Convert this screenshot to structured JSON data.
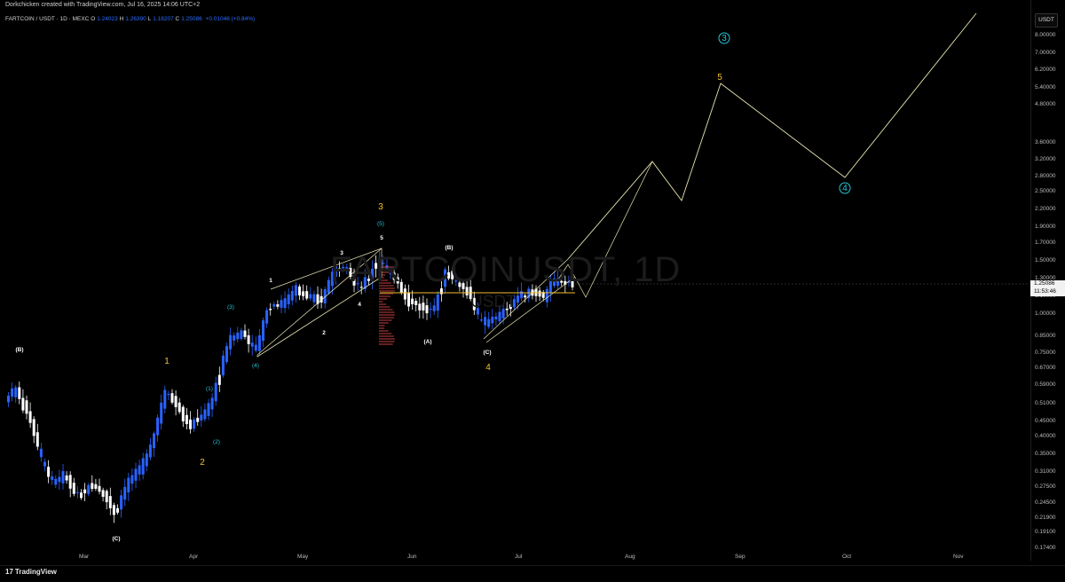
{
  "caption": "Dorkchicken created with TradingView.com, Jul 16, 2025 14:06 UTC+2",
  "symbol": {
    "title": "FARTCOIN / USDT · 1D · MEXC",
    "o_label": "O",
    "o": "1.24023",
    "h_label": "H",
    "h": "1.26390",
    "l_label": "L",
    "l": "1.18207",
    "c_label": "C",
    "c": "1.25086",
    "change": "+0.01046 (+0.84%)"
  },
  "watermark": {
    "main": "FARTCOINUSDT, 1D",
    "sub": "USDT"
  },
  "price_axis": {
    "currency_button": "USDT",
    "ticks": [
      "8.00000",
      "7.00000",
      "6.20000",
      "5.40000",
      "4.80000",
      "3.60000",
      "3.20000",
      "2.80000",
      "2.50000",
      "2.20000",
      "1.90000",
      "1.70000",
      "1.50000",
      "1.30000",
      "1.10000",
      "1.00000",
      "0.85000",
      "0.75000",
      "0.67000",
      "0.59000",
      "0.51000",
      "0.45000",
      "0.40000",
      "0.35000",
      "0.31000",
      "0.27500",
      "0.24500",
      "0.21900",
      "0.19100",
      "0.17400"
    ],
    "last_price": "1.25086",
    "countdown": "11:53:46"
  },
  "time_axis": [
    "Mar",
    "Apr",
    "May",
    "Jun",
    "Jul",
    "Aug",
    "Sep",
    "Oct",
    "Nov"
  ],
  "footer": {
    "brand": "TradingView",
    "brand_mark": "17"
  },
  "colors": {
    "background": "#000000",
    "up_candle": "#2962ff",
    "down_candle": "#ffffff",
    "projection": "#e8e4b0",
    "wave_yellow": "#f2c12e",
    "wave_cyan": "#26c6da",
    "wave_white": "#ffffff",
    "volume_profile": "#b53a3a"
  },
  "wave_labels": [
    {
      "text": "(B)",
      "color": "white"
    },
    {
      "text": "(C)",
      "color": "white"
    },
    {
      "text": "1",
      "color": "yellow"
    },
    {
      "text": "2",
      "color": "yellow"
    },
    {
      "text": "(1)",
      "color": "cyan"
    },
    {
      "text": "(2)",
      "color": "cyan"
    },
    {
      "text": "(3)",
      "color": "cyan"
    },
    {
      "text": "(4)",
      "color": "cyan"
    },
    {
      "text": "1",
      "color": "white"
    },
    {
      "text": "2",
      "color": "white"
    },
    {
      "text": "3",
      "color": "white"
    },
    {
      "text": "4",
      "color": "white"
    },
    {
      "text": "5",
      "color": "white"
    },
    {
      "text": "3",
      "color": "yellow"
    },
    {
      "text": "(5)",
      "color": "cyan"
    },
    {
      "text": "(B)",
      "color": "white"
    },
    {
      "text": "(A)",
      "color": "white"
    },
    {
      "text": "(C)",
      "color": "white"
    },
    {
      "text": "4",
      "color": "yellow"
    },
    {
      "text": "5",
      "color": "yellow"
    },
    {
      "text": "3",
      "color": "cyan-circle"
    },
    {
      "text": "4",
      "color": "cyan-circle"
    }
  ]
}
